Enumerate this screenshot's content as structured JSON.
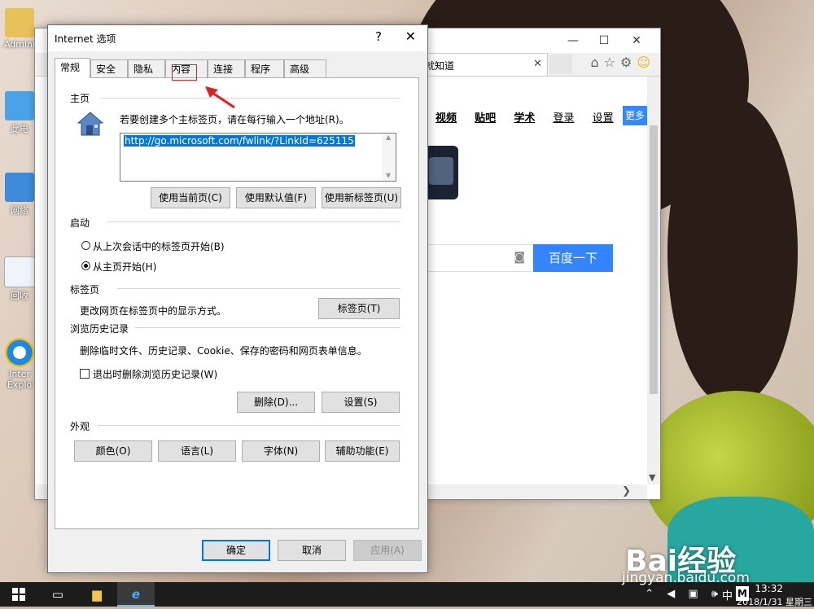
{
  "desktop": {
    "icons": [
      {
        "label": "Admini"
      },
      {
        "label": "此电"
      },
      {
        "label": "网络"
      },
      {
        "label": "回收"
      },
      {
        "label": "Inter Explo"
      }
    ]
  },
  "ie": {
    "tab_title": "就知道",
    "nav_links": [
      "视频",
      "贴吧",
      "学术",
      "登录",
      "设置"
    ],
    "more_label": "更多",
    "search_button": "百度一下",
    "icons": [
      "home-icon",
      "star-icon",
      "gear-icon",
      "smiley-icon"
    ]
  },
  "dialog": {
    "title": "Internet 选项",
    "help_label": "?",
    "close_label": "✕",
    "tabs": [
      "常规",
      "安全",
      "隐私",
      "内容",
      "连接",
      "程序",
      "高级"
    ],
    "active_tab": "常规",
    "highlighted_tab": "内容",
    "homepage": {
      "label": "主页",
      "instruction": "若要创建多个主标签页，请在每行输入一个地址(R)。",
      "url": "http://go.microsoft.com/fwlink/?LinkId=625115",
      "use_current": "使用当前页(C)",
      "use_default": "使用默认值(F)",
      "use_new_tab": "使用新标签页(U)"
    },
    "startup": {
      "label": "启动",
      "option_last_session": "从上次会话中的标签页开始(B)",
      "option_home_page": "从主页开始(H)",
      "selected": "从主页开始(H)"
    },
    "tabs_section": {
      "label": "标签页",
      "description": "更改网页在标签页中的显示方式。",
      "button": "标签页(T)"
    },
    "history": {
      "label": "浏览历史记录",
      "description": "删除临时文件、历史记录、Cookie、保存的密码和网页表单信息。",
      "delete_on_exit": "退出时删除浏览历史记录(W)",
      "delete_on_exit_checked": false,
      "delete_button": "删除(D)...",
      "settings_button": "设置(S)"
    },
    "appearance": {
      "label": "外观",
      "colors": "颜色(O)",
      "languages": "语言(L)",
      "fonts": "字体(N)",
      "accessibility": "辅助功能(E)"
    },
    "footer": {
      "ok": "确定",
      "cancel": "取消",
      "apply": "应用(A)"
    }
  },
  "taskbar": {
    "ime": "中",
    "time": "13:32",
    "date": "2018/1/31 星期三"
  },
  "watermark": {
    "logo": "Bai经验",
    "url": "jingyan.baidu.com"
  },
  "colors": {
    "accent": "#0078d7",
    "baidu_blue": "#3385ff",
    "annotation_red": "#e02020"
  }
}
